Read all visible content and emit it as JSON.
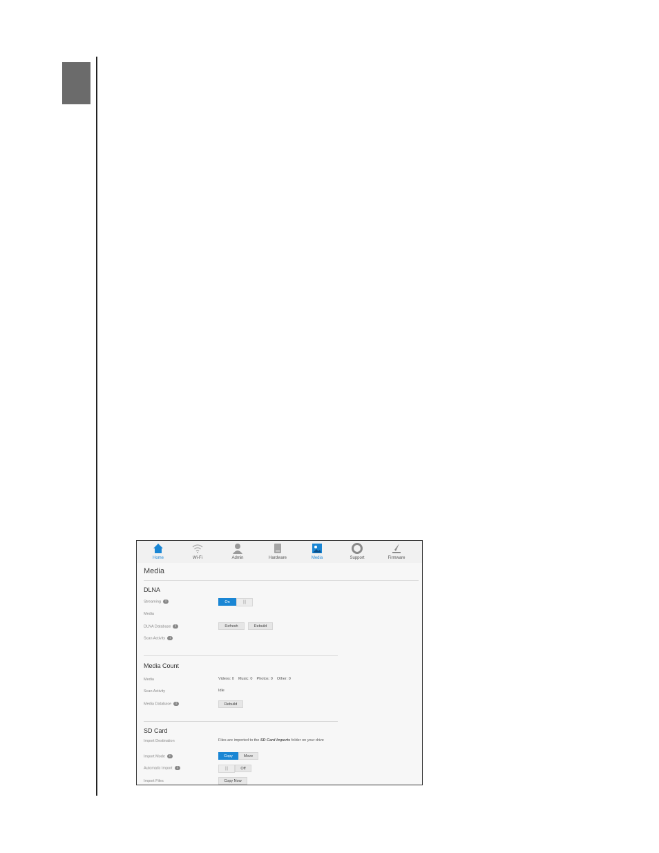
{
  "nav": [
    {
      "label": "Home",
      "icon": "home-icon",
      "active": true
    },
    {
      "label": "Wi-Fi",
      "icon": "wifi-icon",
      "active": false
    },
    {
      "label": "Admin",
      "icon": "user-icon",
      "active": false
    },
    {
      "label": "Hardware",
      "icon": "drive-icon",
      "active": false
    },
    {
      "label": "Media",
      "icon": "media-icon",
      "active": true
    },
    {
      "label": "Support",
      "icon": "lifebuoy-icon",
      "active": false
    },
    {
      "label": "Firmware",
      "icon": "firmware-icon",
      "active": false
    }
  ],
  "page_title": "Media",
  "dlna": {
    "heading": "DLNA",
    "streaming_label": "Streaming",
    "streaming_on": "On",
    "media_label": "Media",
    "database_label": "DLNA Database",
    "refresh": "Refresh",
    "rebuild": "Rebuild",
    "scan_label": "Scan Activity"
  },
  "media_count": {
    "heading": "Media Count",
    "media_label": "Media",
    "counts": "Videos: 0    Music: 0    Photos: 0    Other: 0",
    "scan_label": "Scan Activity",
    "scan_value": "Idle",
    "database_label": "Media Database",
    "rebuild": "Rebuild"
  },
  "sd_card": {
    "heading": "SD Card",
    "dest_label": "Import Destination",
    "dest_pre": "Files are imported to the ",
    "dest_folder": "SD Card Imports",
    "dest_post": " folder on your drive",
    "mode_label": "Import Mode",
    "copy": "Copy",
    "move": "Move",
    "auto_label": "Automatic Import",
    "auto_off": "Off",
    "files_label": "Import Files",
    "copy_now": "Copy Now"
  },
  "colors": {
    "accent": "#1a86d4",
    "tab": "#6b6b6b"
  }
}
